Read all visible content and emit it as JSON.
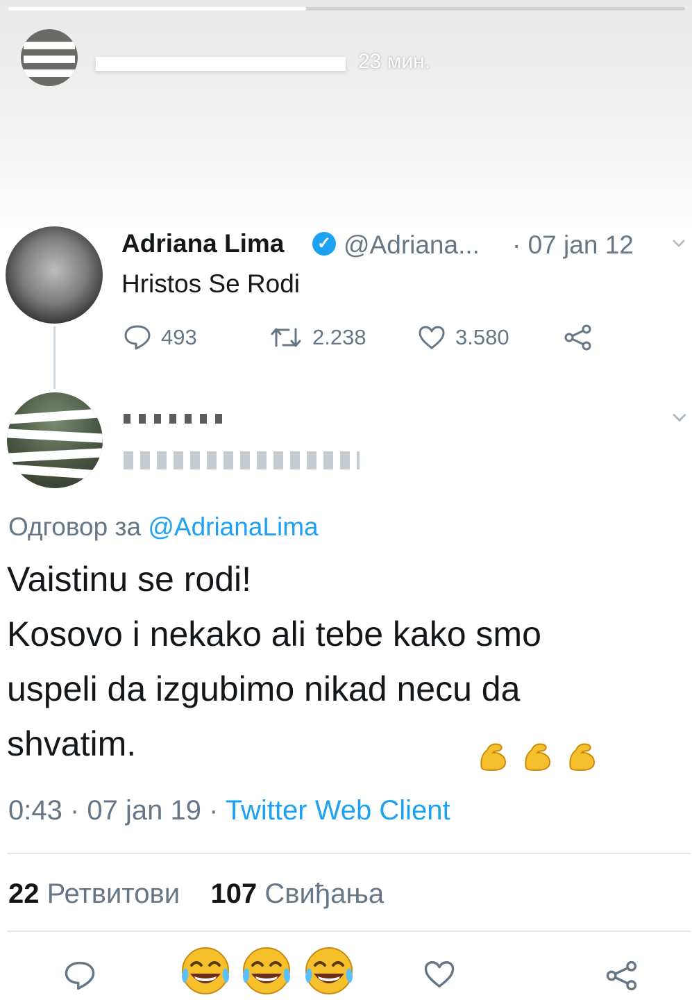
{
  "story": {
    "time": "23 мин.",
    "progress": 0.44
  },
  "tweet": {
    "name": "Adriana Lima",
    "verified": true,
    "handle": "@Adriana...",
    "date": "· 07 jan 12",
    "text": "Hristos Se Rodi",
    "replies": "493",
    "retweets": "2.238",
    "likes": "3.580"
  },
  "reply": {
    "reply_to_label": "Одговор за",
    "reply_to_mention": "@AdrianaLima",
    "lines": [
      "Vaistinu se rodi!",
      "Kosovo i nekako ali tebe kako smo",
      "uspeli da izgubimo nikad necu da",
      "shvatim."
    ],
    "emoji": [
      "flexed-biceps",
      "flexed-biceps",
      "flexed-biceps"
    ],
    "time": "0:43 · 07 jan 19 ·",
    "source": "Twitter Web Client",
    "retweets_count": "22",
    "retweets_label": "Ретвитови",
    "likes_count": "107",
    "likes_label": "Свиђања"
  },
  "colors": {
    "accent": "#1da1f2",
    "secondary_text": "#657786",
    "primary_text": "#14171a",
    "emoji_yellow": "#f5c02b"
  },
  "icons": {
    "reply": "speech-bubble-icon",
    "retweet": "retweet-icon",
    "like": "heart-icon",
    "share": "share-icon",
    "laugh": "face-with-tears-of-joy-icon"
  }
}
